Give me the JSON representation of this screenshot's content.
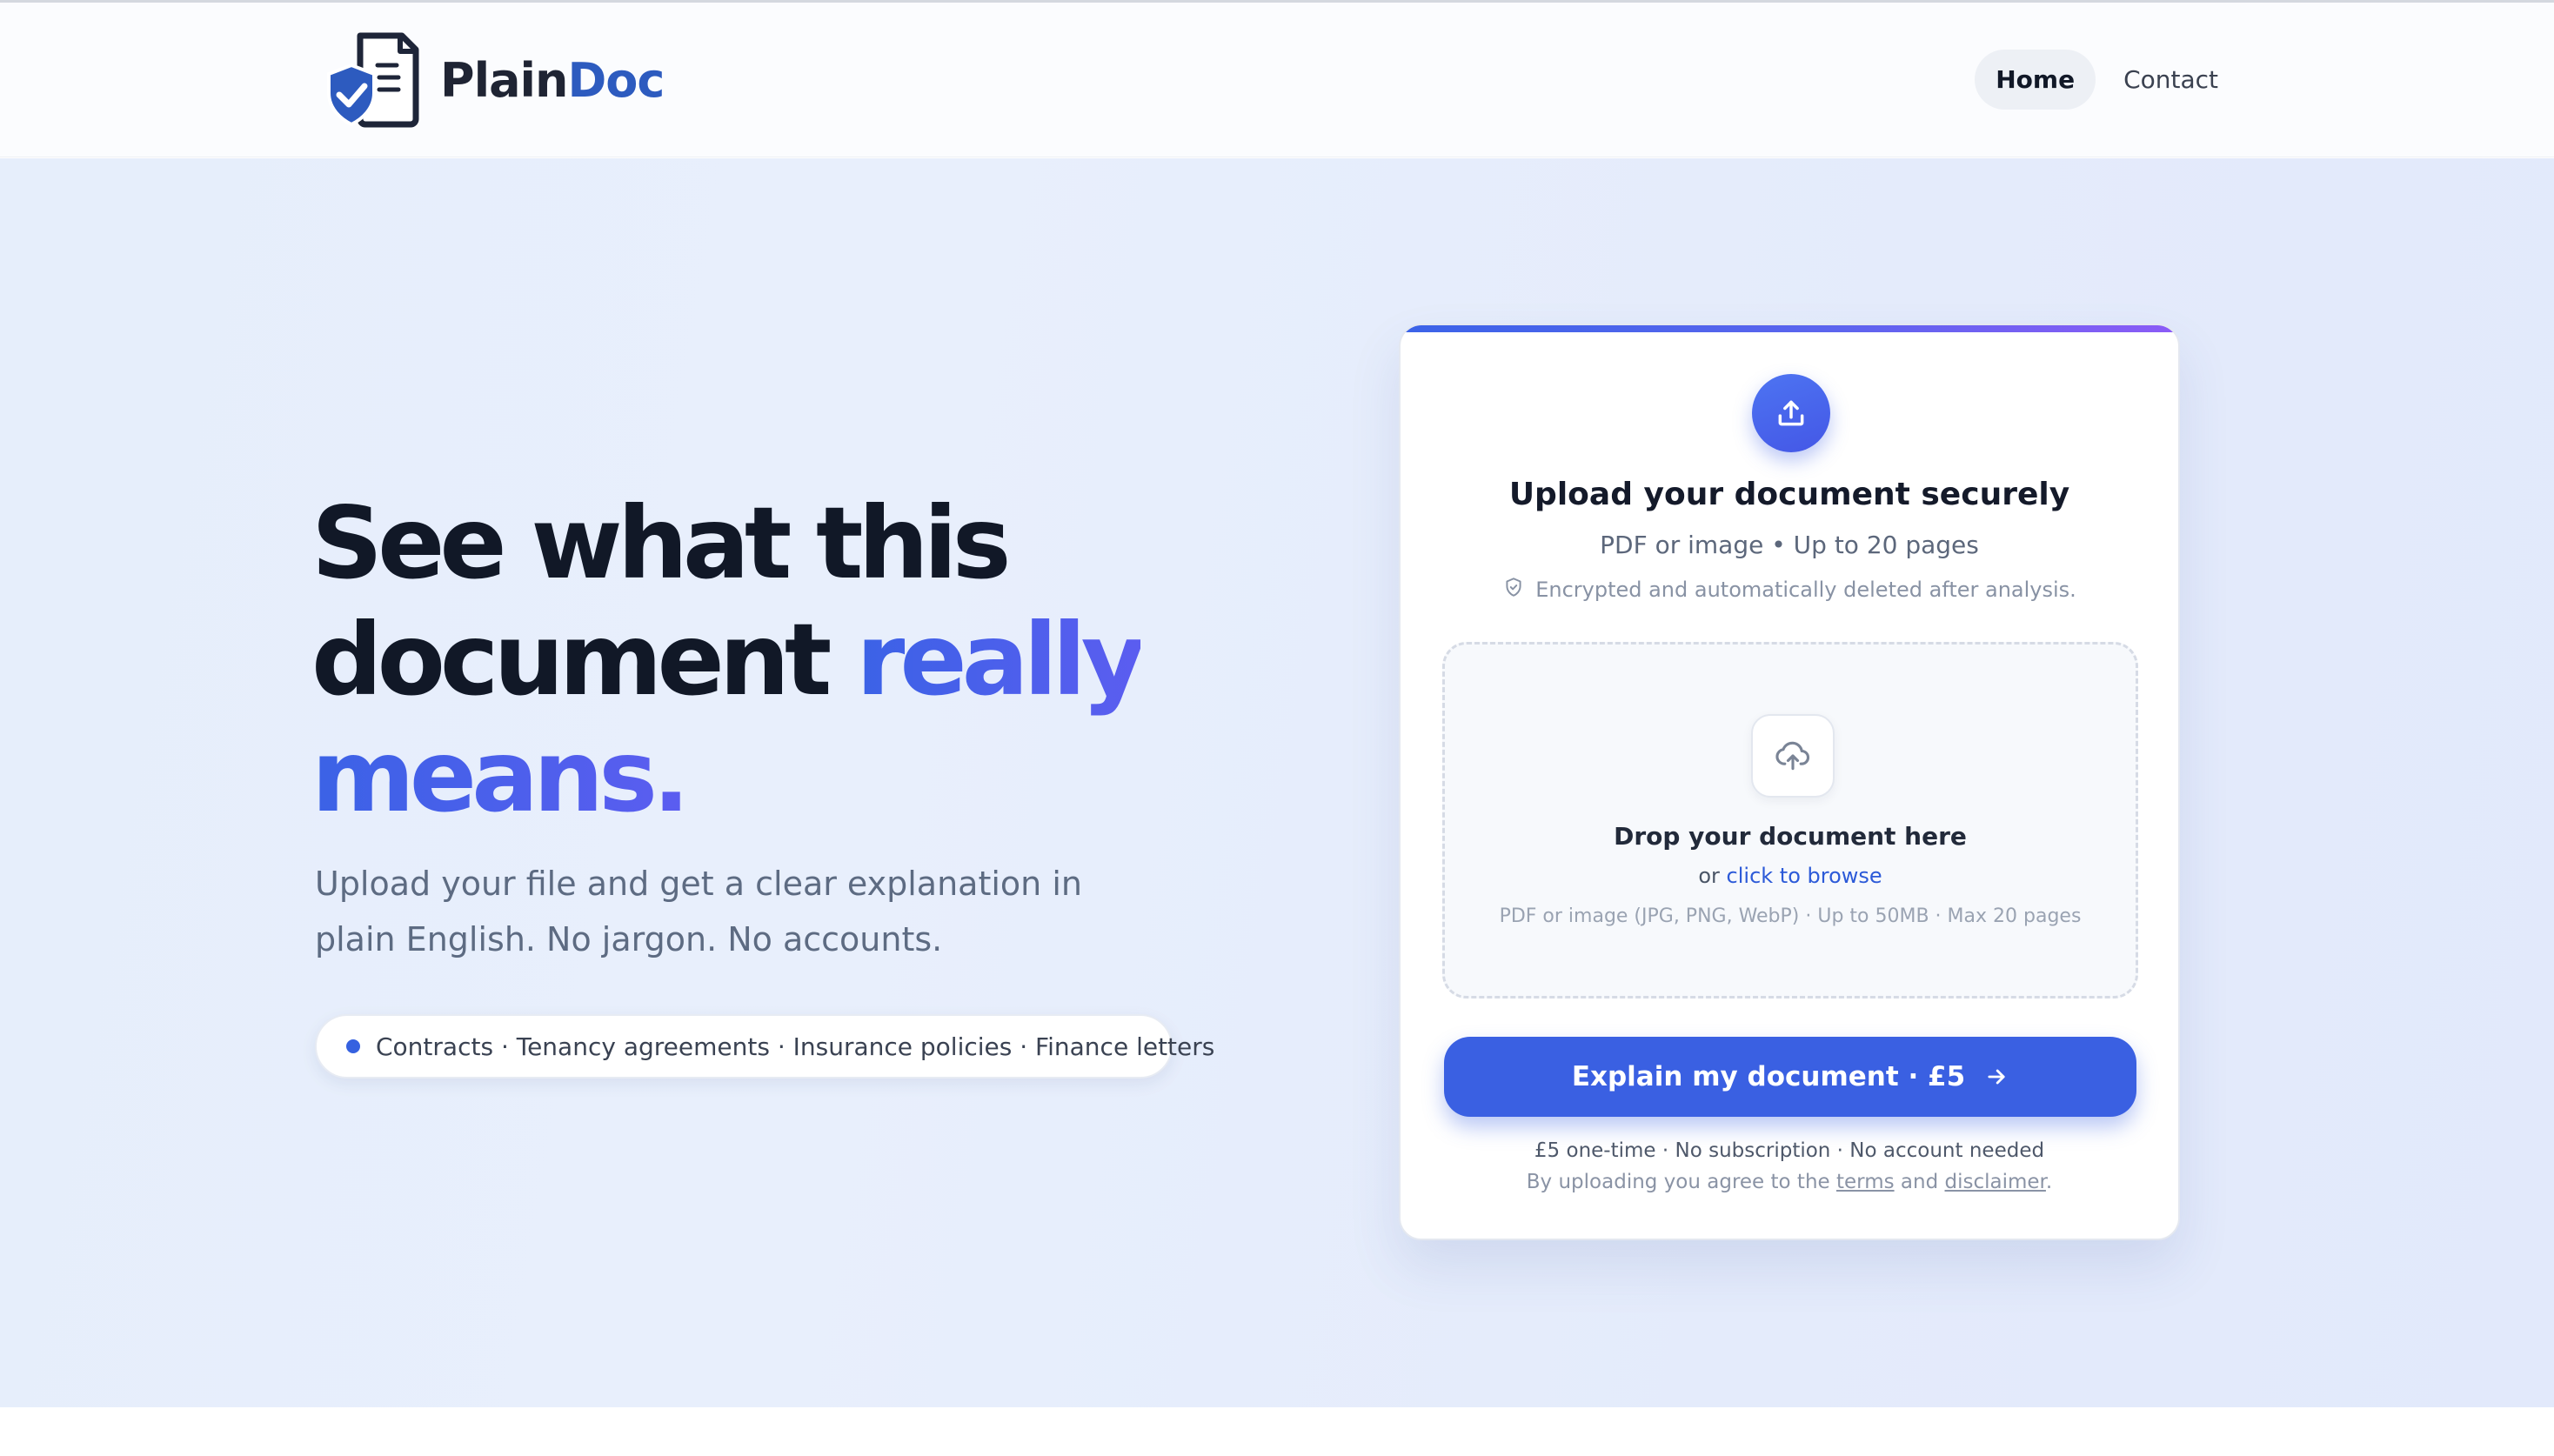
{
  "brand": {
    "name_part1": "Plain",
    "name_part2": "Doc",
    "logo_icon": "document-shield-check-icon"
  },
  "nav": {
    "items": [
      {
        "label": "Home",
        "active": true
      },
      {
        "label": "Contact",
        "active": false
      }
    ]
  },
  "hero": {
    "headline_line1": "See what this",
    "headline_line2a": "document",
    "headline_accent1": "really",
    "headline_accent2": "means.",
    "subcopy": "Upload your file and get a clear explanation in plain English. No jargon. No accounts.",
    "pill_text": "Contracts · Tenancy agreements · Insurance policies · Finance letters"
  },
  "upload_card": {
    "icon": "upload-icon",
    "title": "Upload your document securely",
    "subtitle": "PDF or image • Up to 20 pages",
    "security_note": "Encrypted and automatically deleted after analysis.",
    "dropzone": {
      "icon": "cloud-upload-icon",
      "title": "Drop your document here",
      "browse_prefix": "or",
      "browse_link": "click to browse",
      "hint": "PDF or image (JPG, PNG, WebP) · Up to 50MB · Max 20 pages"
    },
    "cta_label": "Explain my document · £5",
    "fine_print_1": "£5 one-time · No subscription · No account needed",
    "fine_print_2_prefix": "By uploading you agree to the",
    "terms_label": "terms",
    "fine_print_2_mid": "and",
    "disclaimer_label": "disclaimer",
    "fine_print_2_suffix": "."
  },
  "colors": {
    "accent": "#3a60e2",
    "brand_dark": "#1f2433",
    "brand_blue": "#2d5bbf",
    "gradient_purple": "#8b5cf6"
  }
}
